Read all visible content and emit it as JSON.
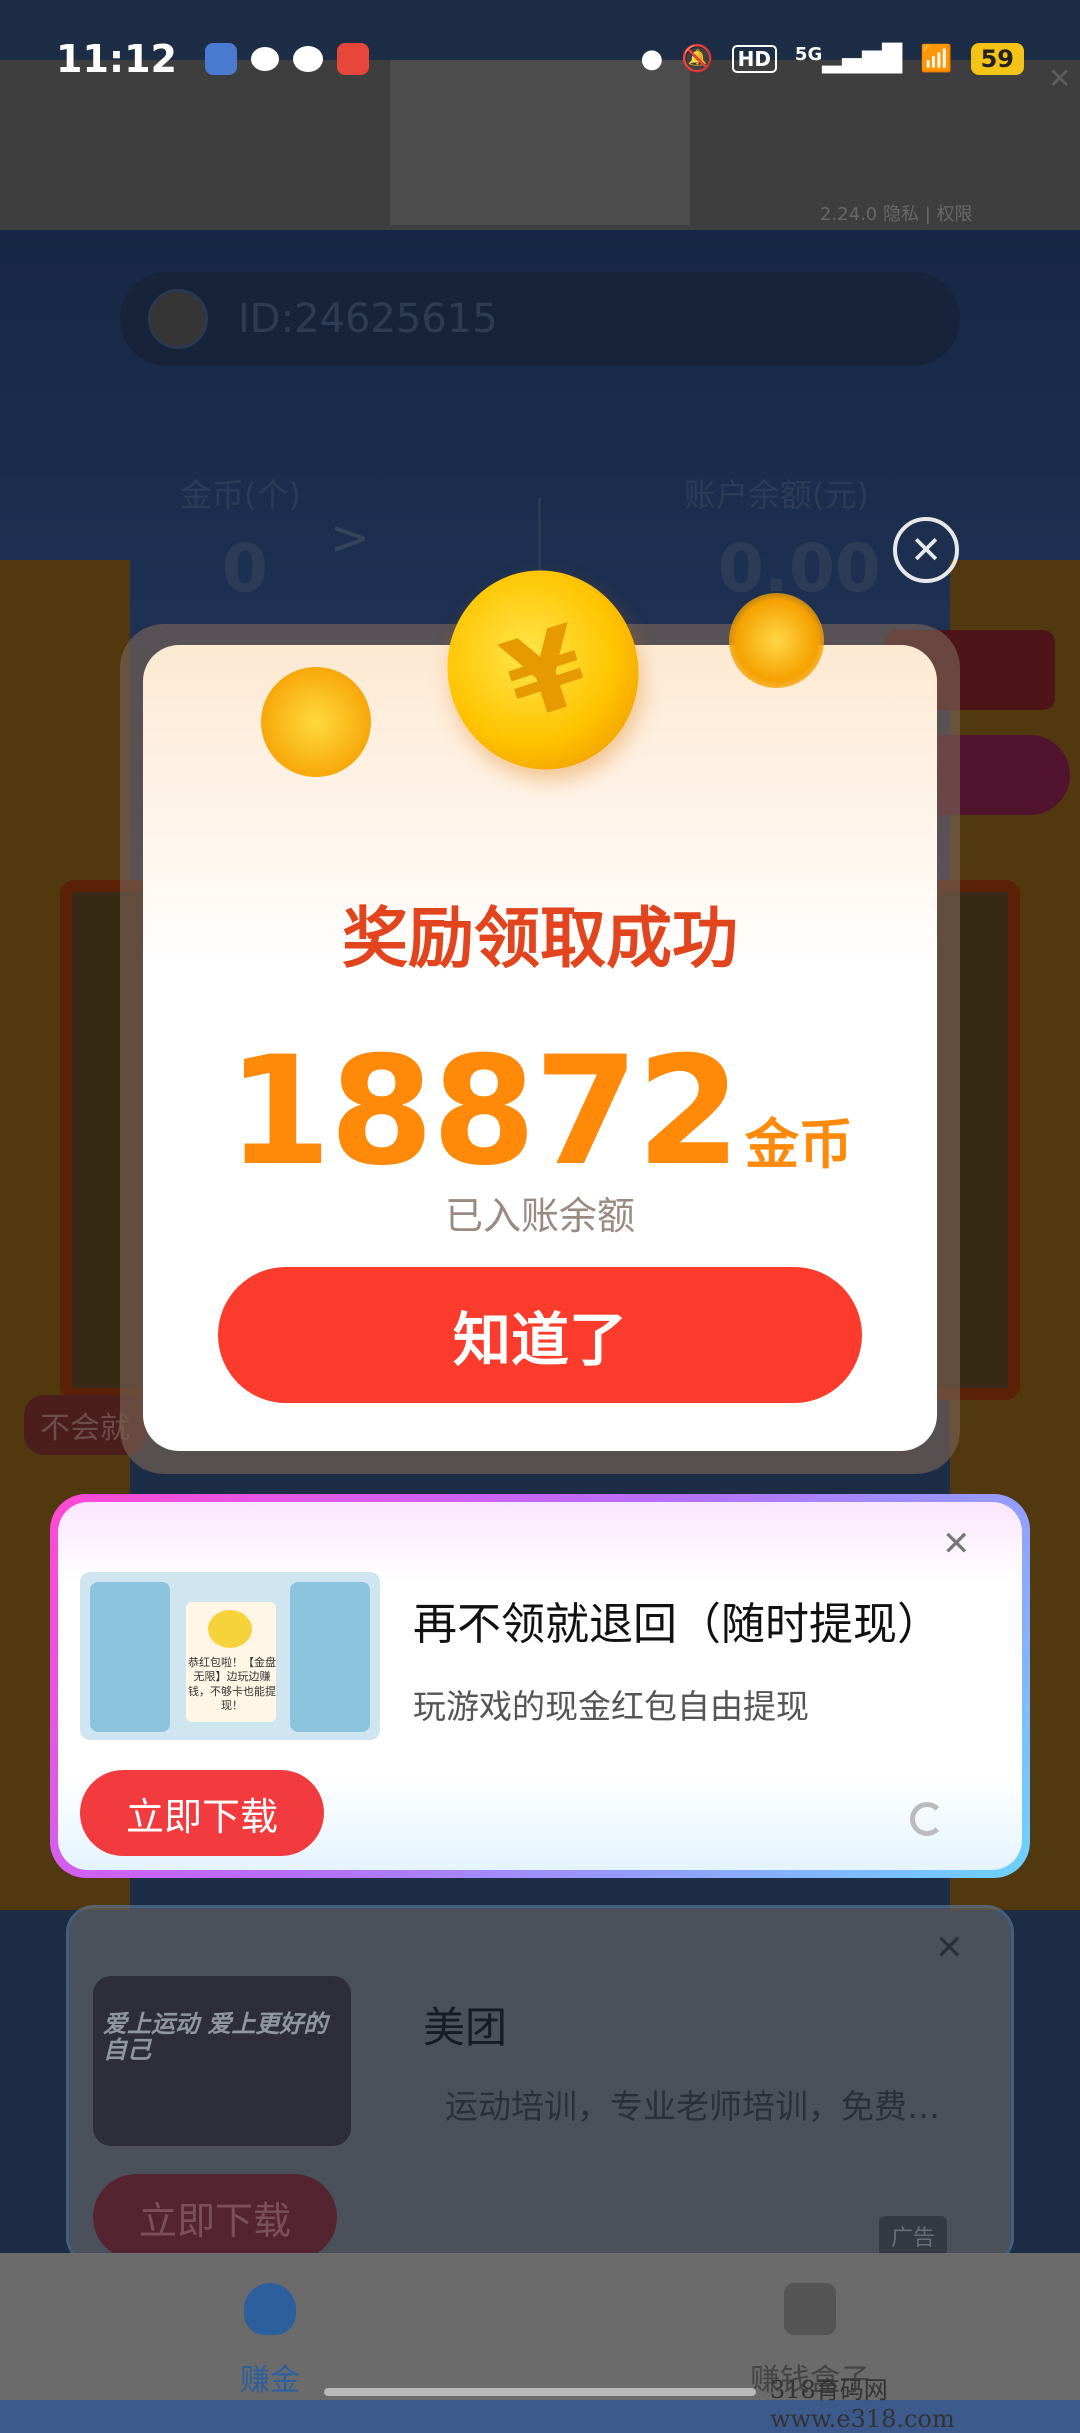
{
  "status_bar": {
    "time": "11:12",
    "network": "5G",
    "hd": "HD",
    "battery": "59"
  },
  "background_page": {
    "top_banner_meta": "2.24.0  隐私 | 权限",
    "user_id": "ID:24625615",
    "stats": [
      {
        "label": "金币(个)",
        "value": "0"
      },
      {
        "label": "账户余额(元)",
        "value": "0.00"
      }
    ],
    "side_tag": "不会就"
  },
  "reward_modal": {
    "title": "奖励领取成功",
    "amount": "18872",
    "unit": "金币",
    "note": "已入账余额",
    "confirm_label": "知道了"
  },
  "ad_primary": {
    "title": "再不领就退回（随时提现）",
    "description": "玩游戏的现金红包自由提现",
    "cta_label": "立即下载",
    "thumb_text": "恭红包啦！【金盘无限】边玩边赚钱，不够卡也能提现！"
  },
  "ad_secondary": {
    "title": "美团",
    "description": "运动培训，专业老师培训，免费…",
    "cta_label": "立即下载",
    "thumb_text": "爱上运动 爱上更好的自己",
    "ad_tag": "广告"
  },
  "bottom_nav": {
    "items": [
      {
        "label": "赚金",
        "icon": "coin-bag-icon",
        "active": true
      },
      {
        "label": "赚钱盒子",
        "icon": "box-icon",
        "active": false
      }
    ]
  },
  "watermark": "318育码网  www.e318.com",
  "colors": {
    "primary_red": "#fb3b2c",
    "reward_orange": "#ff8a0a",
    "title_red": "#e2441e",
    "nav_active": "#2d5f9f"
  }
}
